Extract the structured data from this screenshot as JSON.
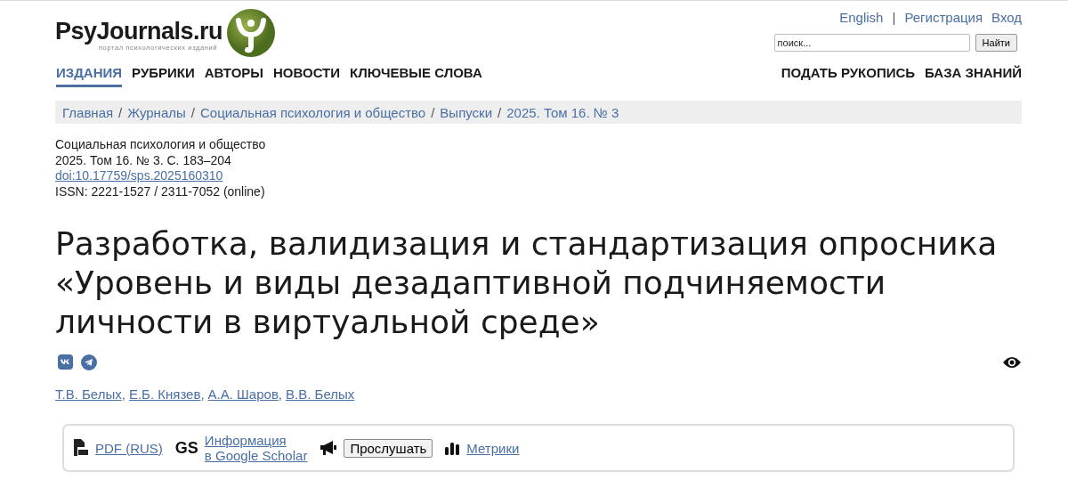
{
  "logo": {
    "title": "PsyJournals.ru",
    "tagline": "портал психологических изданий"
  },
  "top_links": [
    {
      "label": "English"
    },
    {
      "label": "|",
      "kind": "separator"
    },
    {
      "label": "Регистрация"
    },
    {
      "label": "Вход"
    }
  ],
  "search": {
    "placeholder": "поиск...",
    "button": "Найти"
  },
  "nav": [
    {
      "label": "ИЗДАНИЯ",
      "selected": true
    },
    {
      "label": "РУБРИКИ",
      "selected": false
    },
    {
      "label": "АВТОРЫ",
      "selected": false
    },
    {
      "label": "НОВОСТИ",
      "selected": false
    },
    {
      "label": "КЛЮЧЕВЫЕ СЛОВА",
      "selected": false
    }
  ],
  "nav_right": [
    "ПОДАТЬ РУКОПИСЬ",
    "БАЗА ЗНАНИЙ"
  ],
  "breadcrumbs": [
    {
      "kind": "link",
      "text": "Главная"
    },
    {
      "kind": "separator",
      "text": "/"
    },
    {
      "kind": "link",
      "text": "Журналы"
    },
    {
      "kind": "separator",
      "text": "/"
    },
    {
      "kind": "link",
      "text": "Социальная психология и общество"
    },
    {
      "kind": "separator",
      "text": "/"
    },
    {
      "kind": "link",
      "text": "Выпуски"
    },
    {
      "kind": "separator",
      "text": "/"
    },
    {
      "kind": "link",
      "text": "2025. Том 16. № 3"
    }
  ],
  "meta": [
    {
      "text": "Социальная психология и общество",
      "kind": "text"
    },
    {
      "text": "2025. Том 16. № 3. С. 183–204",
      "kind": "text"
    },
    {
      "text": "doi:10.17759/sps.2025160310",
      "kind": "link"
    },
    {
      "text": "ISSN: 2221-1527 / 2311-7052 (online)",
      "kind": "text"
    }
  ],
  "title": "Разработка, валидизация и стандартизация опросника «Уровень и виды дезадаптивной подчиняемости личности в виртуальной среде»",
  "authors": [
    {
      "kind": "link",
      "text": "Т.В. Белых"
    },
    {
      "kind": "separator",
      "text": ","
    },
    {
      "kind": "link",
      "text": "Е.Б. Князев"
    },
    {
      "kind": "separator",
      "text": ","
    },
    {
      "kind": "link",
      "text": "А.А. Шаров"
    },
    {
      "kind": "separator",
      "text": ","
    },
    {
      "kind": "link",
      "text": "В.В. Белых"
    }
  ],
  "tools": [
    {
      "kind": "pdf",
      "label": "PDF (RUS)"
    },
    {
      "kind": "scholar",
      "badge": "GS",
      "label": "Информация",
      "label2": "в Google Scholar"
    },
    {
      "kind": "listen",
      "label": "Прослушать"
    },
    {
      "kind": "metrics",
      "label": "Метрики"
    }
  ]
}
